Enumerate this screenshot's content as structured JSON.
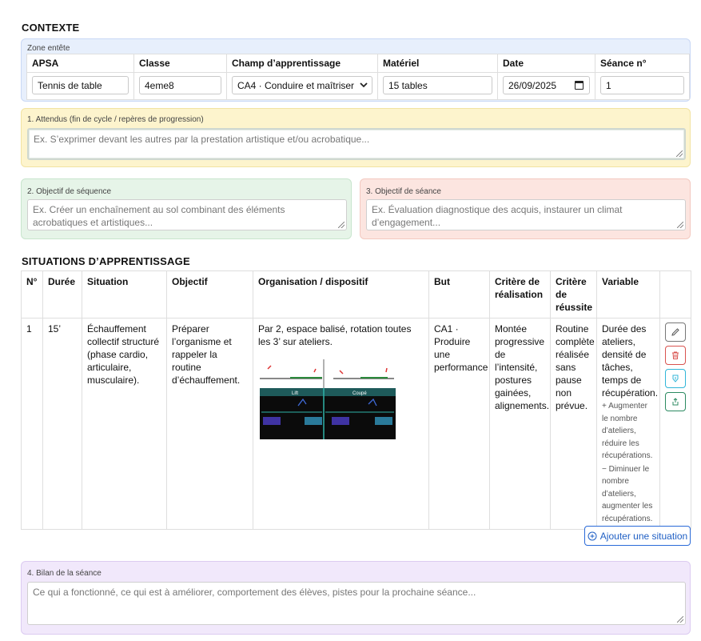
{
  "contexte": {
    "title": "CONTEXTE",
    "zone_label": "Zone entête",
    "headers": [
      "APSA",
      "Classe",
      "Champ d’apprentissage",
      "Matériel",
      "Date",
      "Séance n°"
    ],
    "apsa": "Tennis de table",
    "classe": "4eme8",
    "champ": "CA4 · Conduire et maîtriser un affrontement",
    "materiel": "15 tables",
    "date": "26/09/2025",
    "seance": "1"
  },
  "attendus": {
    "label": "1. Attendus (fin de cycle / repères de progression)",
    "placeholder": "Ex. S’exprimer devant les autres par la prestation artistique et/ou acrobatique..."
  },
  "objectif_sequence": {
    "label": "2. Objectif de séquence",
    "placeholder": "Ex. Créer un enchaînement au sol combinant des éléments acrobatiques et artistiques..."
  },
  "objectif_seance": {
    "label": "3. Objectif de séance",
    "placeholder": "Ex. Évaluation diagnostique des acquis, instaurer un climat d’engagement..."
  },
  "situations": {
    "title": "SITUATIONS D’APPRENTISSAGE",
    "headers": {
      "num": "N°",
      "duree": "Durée",
      "situation": "Situation",
      "objectif": "Objectif",
      "organisation": "Organisation / dispositif",
      "but": "But",
      "critere_realisation": "Critère de réalisation",
      "critere_reussite": "Critère de réussite",
      "variable": "Variable"
    },
    "rows": [
      {
        "num": "1",
        "duree": "15’",
        "situation": "Échauffement collectif structuré (phase cardio, articulaire, musculaire).",
        "objectif": "Préparer l’organisme et rappeler la routine d’échauffement.",
        "organisation": "Par 2, espace balisé, rotation toutes les 3’ sur ateliers.",
        "but": "CA1 · Produire une performance",
        "critere_realisation": "Montée progressive de l’intensité, postures gainées, alignements.",
        "critere_reussite": "Routine complète réalisée sans pause non prévue.",
        "variable": "Durée des ateliers, densité de tâches, temps de récupération.",
        "variable_plus": "+ Augmenter le nombre d’ateliers, réduire les récupérations.",
        "variable_minus": "− Diminuer le nombre d’ateliers, augmenter les récupérations.",
        "diagram": {
          "left_title": "Lift",
          "right_title": "Coupé"
        }
      }
    ],
    "add_label": "Ajouter une situation"
  },
  "bilan": {
    "label": "4. Bilan de la séance",
    "placeholder": "Ce qui a fonctionné, ce qui est à améliorer, comportement des élèves, pistes pour la prochaine séance..."
  },
  "colors": {
    "accent": "#1f5fc4",
    "danger": "#d9534f",
    "info": "#31b6d8",
    "success": "#2c8a61"
  }
}
